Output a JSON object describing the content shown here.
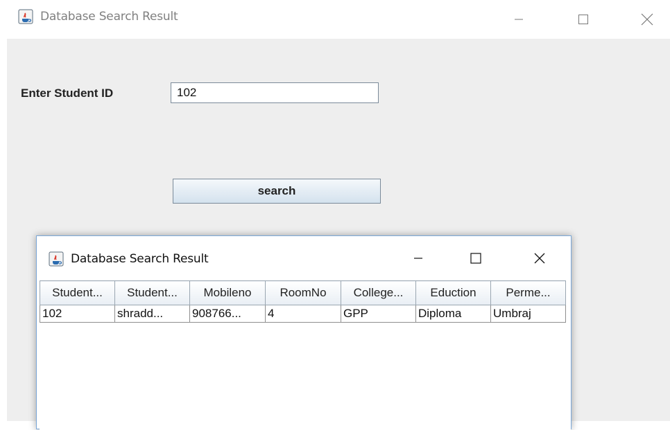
{
  "main_window": {
    "title": "Database Search Result",
    "student_id_label": "Enter Student ID",
    "student_id_value": "102",
    "search_label": "search"
  },
  "dialog": {
    "title": "Database Search Result",
    "columns": [
      "Student...",
      "Student...",
      "Mobileno",
      "RoomNo",
      "College...",
      "Eduction",
      "Perme..."
    ],
    "rows": [
      [
        "102",
        "shradd...",
        "908766...",
        "4",
        "GPP",
        "Diploma",
        "Umbraj"
      ]
    ]
  },
  "icons": {
    "app": "java-cup-icon",
    "minimize": "minimize-icon",
    "maximize": "maximize-icon",
    "close": "close-icon"
  }
}
